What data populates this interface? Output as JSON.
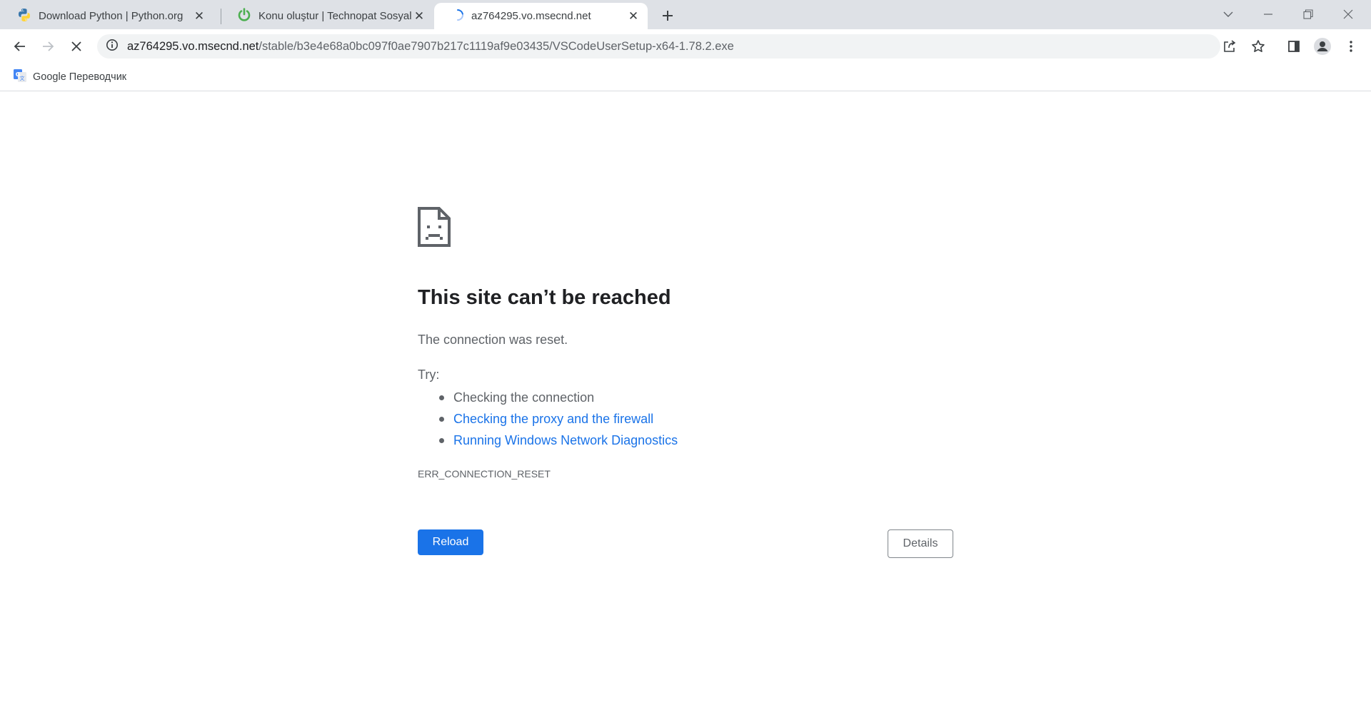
{
  "tabs": [
    {
      "title": "Download Python | Python.org",
      "icon": "python-icon",
      "active": false
    },
    {
      "title": "Konu oluştur | Technopat Sosyal",
      "icon": "power-icon",
      "active": false
    },
    {
      "title": "az764295.vo.msecnd.net",
      "icon": "loading-spinner-icon",
      "active": true
    }
  ],
  "toolbar": {
    "url_host": "az764295.vo.msecnd.net",
    "url_path": "/stable/b3e4e68a0bc097f0ae7907b217c1119af9e03435/VSCodeUserSetup-x64-1.78.2.exe"
  },
  "bookmarks": [
    {
      "label": "Google Переводчик",
      "icon": "google-translate-icon"
    }
  ],
  "error_page": {
    "title": "This site can’t be reached",
    "description": "The connection was reset.",
    "try_label": "Try:",
    "suggestions": [
      {
        "text": "Checking the connection",
        "link": false
      },
      {
        "text": "Checking the proxy and the firewall",
        "link": true
      },
      {
        "text": "Running Windows Network Diagnostics",
        "link": true
      }
    ],
    "error_code": "ERR_CONNECTION_RESET",
    "reload_label": "Reload",
    "details_label": "Details"
  },
  "colors": {
    "accent": "#1a73e8",
    "tabstrip_bg": "#dee1e6",
    "text_secondary": "#5f6368"
  }
}
